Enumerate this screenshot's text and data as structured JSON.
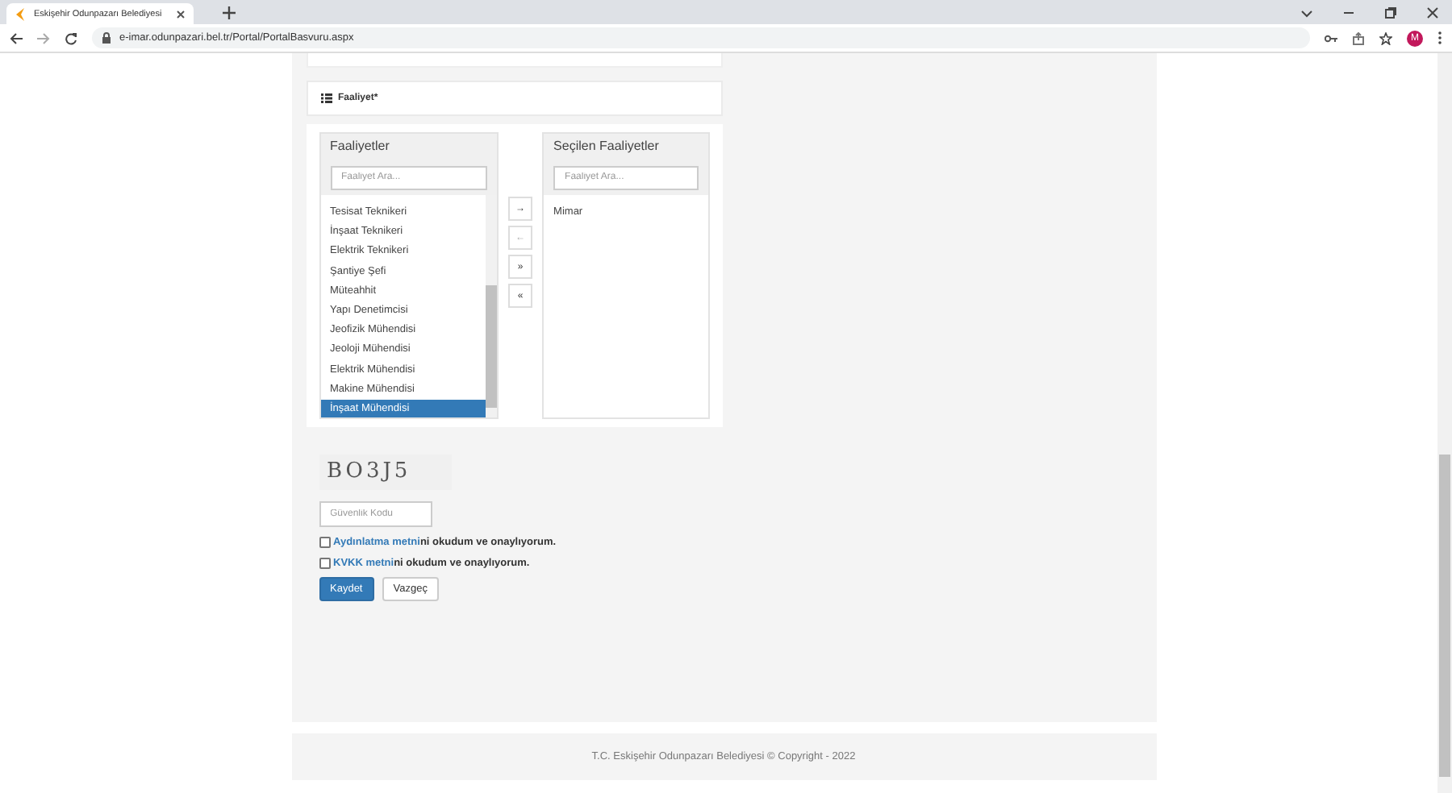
{
  "browser": {
    "tab_title": "Eskişehir Odunpazarı Belediyesi",
    "url": "e-imar.odunpazari.bel.tr/Portal/PortalBasvuru.aspx",
    "profile_initial": "M"
  },
  "section": {
    "title": "Faaliyet*"
  },
  "available": {
    "title": "Faaliyetler",
    "search_placeholder": "Faaliyet Ara...",
    "items": [
      {
        "label": "Tesisat Teknikeri",
        "selected": false
      },
      {
        "label": "İnşaat Teknikeri",
        "selected": false
      },
      {
        "label": "Elektrik Teknikeri",
        "selected": false
      },
      {
        "label": "Şantiye Şefi",
        "selected": false
      },
      {
        "label": "Müteahhit",
        "selected": false
      },
      {
        "label": "Yapı Denetimcisi",
        "selected": false
      },
      {
        "label": "Jeofizik Mühendisi",
        "selected": false
      },
      {
        "label": "Jeoloji Mühendisi",
        "selected": false
      },
      {
        "label": "Elektrik Mühendisi",
        "selected": false
      },
      {
        "label": "Makine Mühendisi",
        "selected": false
      },
      {
        "label": "İnşaat Mühendisi",
        "selected": true
      }
    ]
  },
  "move_buttons": [
    {
      "label": "→",
      "disabled": false
    },
    {
      "label": "←",
      "disabled": true
    },
    {
      "label": "»",
      "disabled": false
    },
    {
      "label": "«",
      "disabled": false
    }
  ],
  "chosen": {
    "title": "Seçilen Faaliyetler",
    "search_placeholder": "Faaliyet Ara...",
    "items": [
      {
        "label": "Mimar",
        "selected": false
      }
    ]
  },
  "captcha": {
    "text": "BO3J5",
    "placeholder": "Güvenlik Kodu"
  },
  "consents": [
    {
      "link": "Aydınlatma metni",
      "text": "ni okudum ve onaylıyorum.",
      "checked": false
    },
    {
      "link": "KVKK metni",
      "text": "ni okudum ve onaylıyorum.",
      "checked": false
    }
  ],
  "buttons": [
    {
      "label": "Kaydet",
      "kind": "primary"
    },
    {
      "label": "Vazgeç",
      "kind": "default"
    }
  ],
  "footer": "T.C. Eskişehir Odunpazarı Belediyesi © Copyright - 2022"
}
